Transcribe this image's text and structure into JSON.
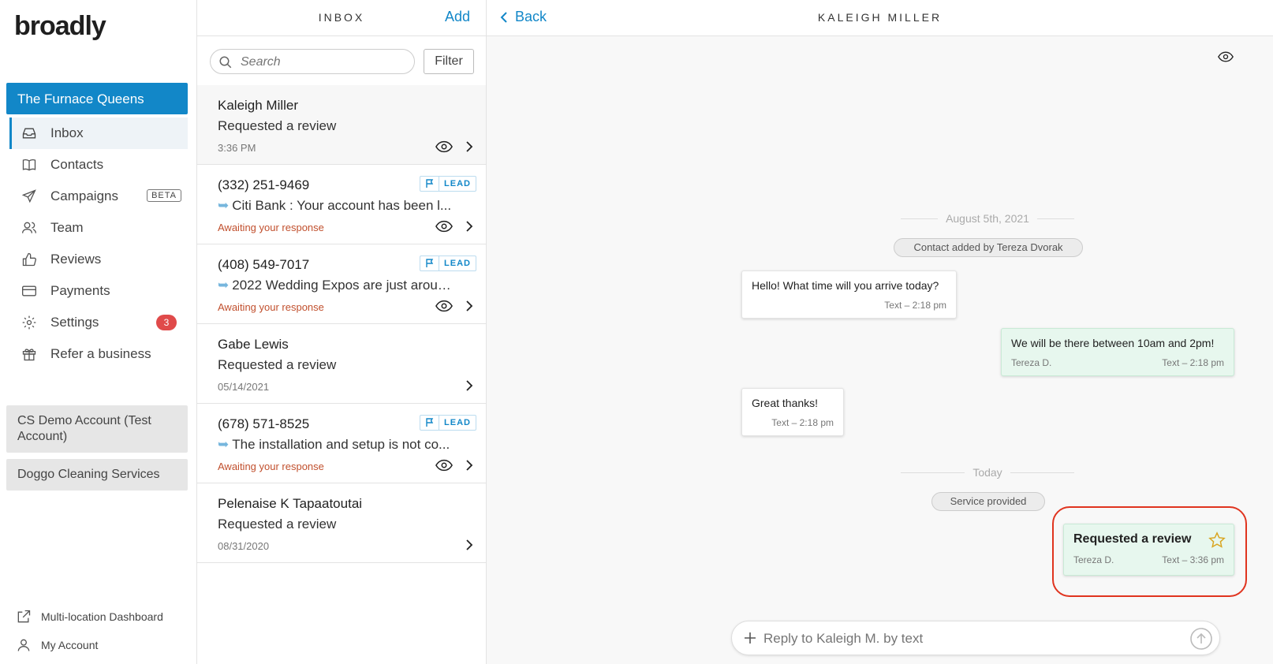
{
  "brand": {
    "name": "broadly"
  },
  "sidebar": {
    "active_account": "The Furnace Queens",
    "nav": [
      {
        "label": "Inbox",
        "icon": "inbox-icon"
      },
      {
        "label": "Contacts",
        "icon": "book-icon"
      },
      {
        "label": "Campaigns",
        "icon": "paper-plane-icon",
        "badge": "BETA"
      },
      {
        "label": "Team",
        "icon": "users-icon"
      },
      {
        "label": "Reviews",
        "icon": "thumbs-up-icon"
      },
      {
        "label": "Payments",
        "icon": "credit-card-icon"
      },
      {
        "label": "Settings",
        "icon": "gear-icon",
        "count": "3"
      },
      {
        "label": "Refer a business",
        "icon": "gift-icon"
      }
    ],
    "other_accounts": [
      "CS Demo Account (Test Account)",
      "Doggo Cleaning Services"
    ],
    "footer": {
      "multi_location": "Multi-location Dashboard",
      "my_account": "My Account"
    }
  },
  "inbox": {
    "title": "INBOX",
    "add_label": "Add",
    "search_placeholder": "Search",
    "filter_label": "Filter",
    "conversations": [
      {
        "name": "Kaleigh Miller",
        "message": "Requested a review",
        "meta": "3:36 PM"
      },
      {
        "name": "(332) 251-9469",
        "message": "Citi Bank : Your account has been l...",
        "meta": "Awaiting your response",
        "badge": "LEAD"
      },
      {
        "name": "(408) 549-7017",
        "message": "2022 Wedding Expos are just aroun...",
        "meta": "Awaiting your response",
        "badge": "LEAD"
      },
      {
        "name": "Gabe Lewis",
        "message": "Requested a review",
        "meta": "05/14/2021"
      },
      {
        "name": "(678) 571-8525",
        "message": "The installation and setup is not co...",
        "meta": "Awaiting your response",
        "badge": "LEAD"
      },
      {
        "name": "Pelenaise K Tapaatoutai",
        "message": "Requested a review",
        "meta": "08/31/2020"
      }
    ]
  },
  "thread": {
    "back_label": "Back",
    "contact_name": "KALEIGH MILLER",
    "date_1": "August 5th, 2021",
    "system_1": "Contact added by Tereza Dvorak",
    "messages": [
      {
        "body": "Hello! What time will you arrive today?",
        "sender": "",
        "meta": "Text – 2:18 pm"
      },
      {
        "body": "We will be there between 10am and 2pm!",
        "sender": "Tereza D.",
        "meta": "Text – 2:18 pm"
      },
      {
        "body": "Great thanks!",
        "sender": "",
        "meta": "Text – 2:18 pm"
      }
    ],
    "date_2": "Today",
    "system_2": "Service provided",
    "review": {
      "title": "Requested a review",
      "sender": "Tereza D.",
      "meta": "Text – 3:36 pm"
    },
    "reply_placeholder": "Reply to Kaleigh M. by text"
  },
  "colors": {
    "accent": "#1287c8",
    "awaiting": "#c1502e",
    "highlight": "#e0341f",
    "outbound_bubble": "#e7f7ee"
  }
}
